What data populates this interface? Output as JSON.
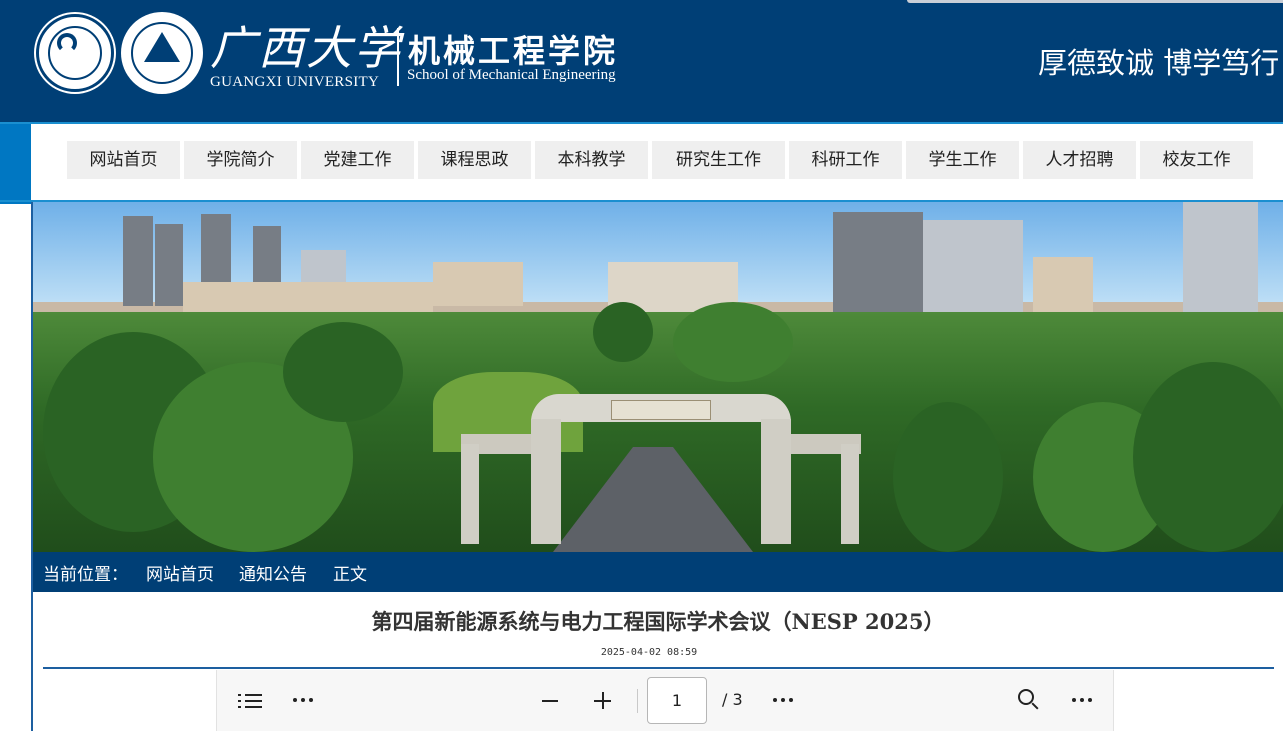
{
  "header": {
    "university_cn": "广西大学",
    "university_en": "GUANGXI UNIVERSITY",
    "school_cn": "机械工程学院",
    "school_en": "School of Mechanical Engineering",
    "motto": "厚德致诚 博学笃行",
    "bg_color": "#003f76"
  },
  "nav": {
    "items": [
      {
        "label": "网站首页"
      },
      {
        "label": "学院简介"
      },
      {
        "label": "党建工作"
      },
      {
        "label": "课程思政"
      },
      {
        "label": "本科教学"
      },
      {
        "label": "研究生工作"
      },
      {
        "label": "科研工作"
      },
      {
        "label": "学生工作"
      },
      {
        "label": "人才招聘"
      },
      {
        "label": "校友工作"
      }
    ],
    "accent_color": "#0077c2"
  },
  "breadcrumb": {
    "prefix": "当前位置：",
    "items": [
      "网站首页",
      "通知公告",
      "正文"
    ]
  },
  "article": {
    "title": "第四届新能源系统与电力工程国际学术会议（NESP 2025）",
    "date": "2025-04-02 08:59"
  },
  "pdf_viewer": {
    "current_page": "1",
    "total_pages": "/ 3",
    "icons": [
      "list-icon",
      "more-icon",
      "zoom-out-icon",
      "zoom-in-icon",
      "more-icon",
      "search-icon",
      "more-icon"
    ]
  }
}
